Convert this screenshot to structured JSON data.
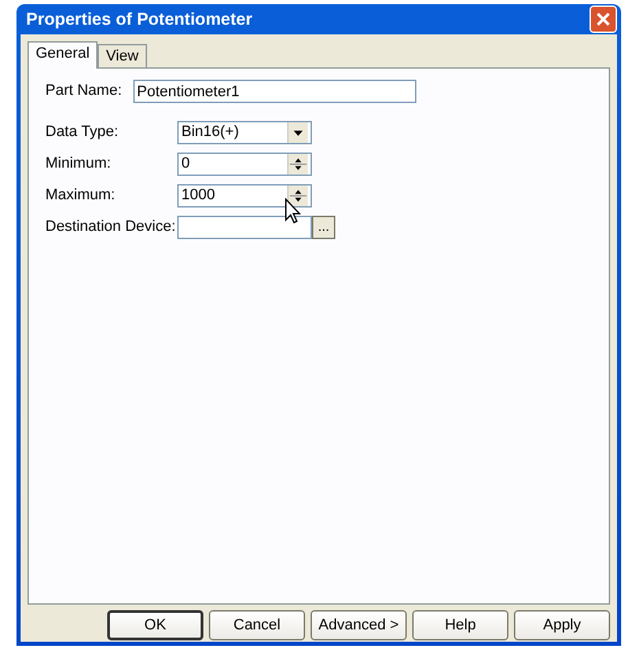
{
  "window": {
    "title": "Properties of Potentiometer"
  },
  "tabs": [
    {
      "label": "General",
      "selected": true
    },
    {
      "label": "View",
      "selected": false
    }
  ],
  "fields": [
    {
      "kind": "text",
      "label": "Part Name:",
      "value": "Potentiometer1"
    },
    {
      "kind": "dropdown",
      "label": "Data Type:",
      "value": "Bin16(+)"
    },
    {
      "kind": "spinner",
      "label": "Minimum:",
      "value": "0"
    },
    {
      "kind": "spinner",
      "label": "Maximum:",
      "value": "1000"
    },
    {
      "kind": "browse",
      "label": "Destination Device:",
      "browse_label": "..."
    }
  ],
  "buttons": [
    {
      "label": "OK",
      "default": true
    },
    {
      "label": "Cancel",
      "default": false
    },
    {
      "label": "Advanced >",
      "default": false
    },
    {
      "label": "Help",
      "default": false
    },
    {
      "label": "Apply",
      "default": false
    }
  ]
}
